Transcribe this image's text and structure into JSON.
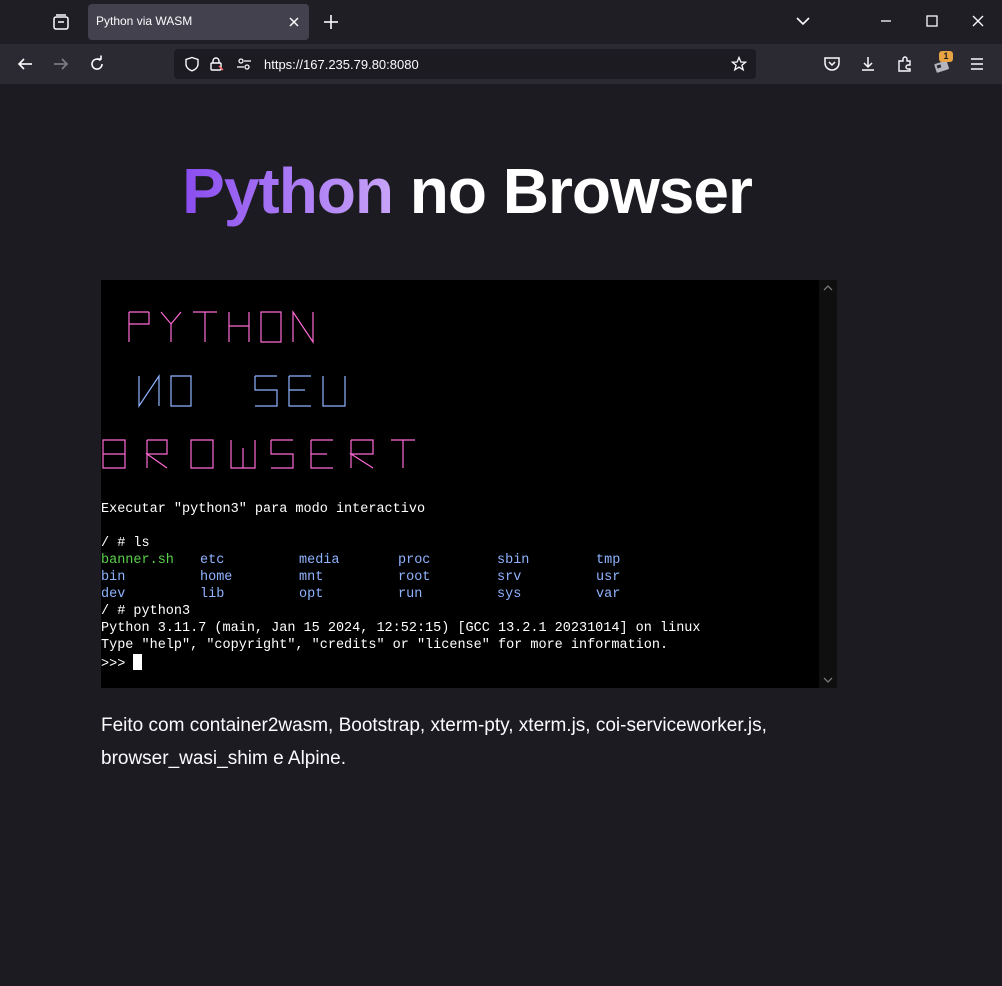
{
  "browser": {
    "tab_title": "Python via WASM",
    "url": "https://167.235.79.80:8080",
    "extension_badge": "1",
    "colors": {
      "tab_bg": "#42414d",
      "toolbar_bg": "#2b2a33",
      "page_bg": "#1c1b22",
      "badge": "#e8a342"
    },
    "icons": [
      "tab-list-icon",
      "close-icon",
      "new-tab-icon",
      "chevron-down-icon",
      "minimize-icon",
      "maximize-icon",
      "window-close-icon",
      "back-icon",
      "forward-icon",
      "reload-icon",
      "shield-icon",
      "lock-icon",
      "permissions-icon",
      "bookmark-star-icon",
      "pocket-icon",
      "download-icon",
      "extensions-icon",
      "extension-icon",
      "menu-icon"
    ]
  },
  "page": {
    "title_accent": "Python",
    "title_rest": "no Browser",
    "colors": {
      "title_gradient_start": "#8a4cf0",
      "title_gradient_end": "#c8a4f8"
    },
    "terminal": {
      "banner_note": "Executar \"python3\" para modo interactivo",
      "cmd_ls": "/ # ls",
      "ls_rows": [
        [
          "banner.sh",
          "etc",
          "media",
          "proc",
          "sbin",
          "tmp"
        ],
        [
          "bin",
          "home",
          "mnt",
          "root",
          "srv",
          "usr"
        ],
        [
          "dev",
          "lib",
          "opt",
          "run",
          "sys",
          "var"
        ]
      ],
      "cmd_python": "/ # python3",
      "python_version": "Python 3.11.7 (main, Jan 15 2024, 12:52:15) [GCC 13.2.1 20231014] on linux",
      "python_help": "Type \"help\", \"copyright\", \"credits\" or \"license\" for more information.",
      "prompt": ">>> ",
      "colors": {
        "exec_file": "#5ad14b",
        "directory": "#8fb3ff",
        "banner_pink": "#ff6ad5",
        "banner_blue": "#8fb3ff"
      }
    },
    "footer_text": "Feito com container2wasm, Bootstrap, xterm-pty, xterm.js, coi-serviceworker.js, browser_wasi_shim e Alpine."
  }
}
